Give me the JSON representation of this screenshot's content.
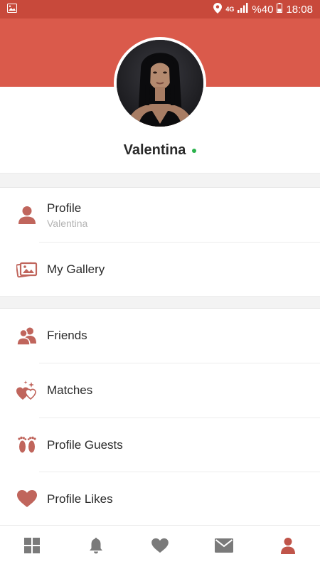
{
  "status_bar": {
    "network": "4G",
    "battery_text": "%40",
    "time": "18:08",
    "image_icon": "image-icon",
    "location_icon": "location-icon",
    "signal_icon": "signal-icon",
    "battery_icon": "battery-icon"
  },
  "colors": {
    "status_bar": "#c8493b",
    "header": "#da5a4b",
    "accent_icon": "#c0655c",
    "online": "#2bb24c",
    "nav_inactive": "#7a7a7a",
    "nav_active": "#c0554a"
  },
  "profile": {
    "name": "Valentina",
    "online": true
  },
  "menu": {
    "section1": [
      {
        "label": "Profile",
        "sublabel": "Valentina",
        "icon": "person-icon"
      },
      {
        "label": "My Gallery",
        "icon": "gallery-icon"
      }
    ],
    "section2": [
      {
        "label": "Friends",
        "icon": "friends-icon"
      },
      {
        "label": "Matches",
        "icon": "matches-icon"
      },
      {
        "label": "Profile Guests",
        "icon": "footprints-icon"
      },
      {
        "label": "Profile Likes",
        "icon": "heart-icon"
      }
    ]
  },
  "bottom_nav": [
    {
      "icon": "grid-icon",
      "active": false
    },
    {
      "icon": "bell-icon",
      "active": false
    },
    {
      "icon": "heart-icon",
      "active": false
    },
    {
      "icon": "mail-icon",
      "active": false
    },
    {
      "icon": "person-icon",
      "active": true
    }
  ]
}
